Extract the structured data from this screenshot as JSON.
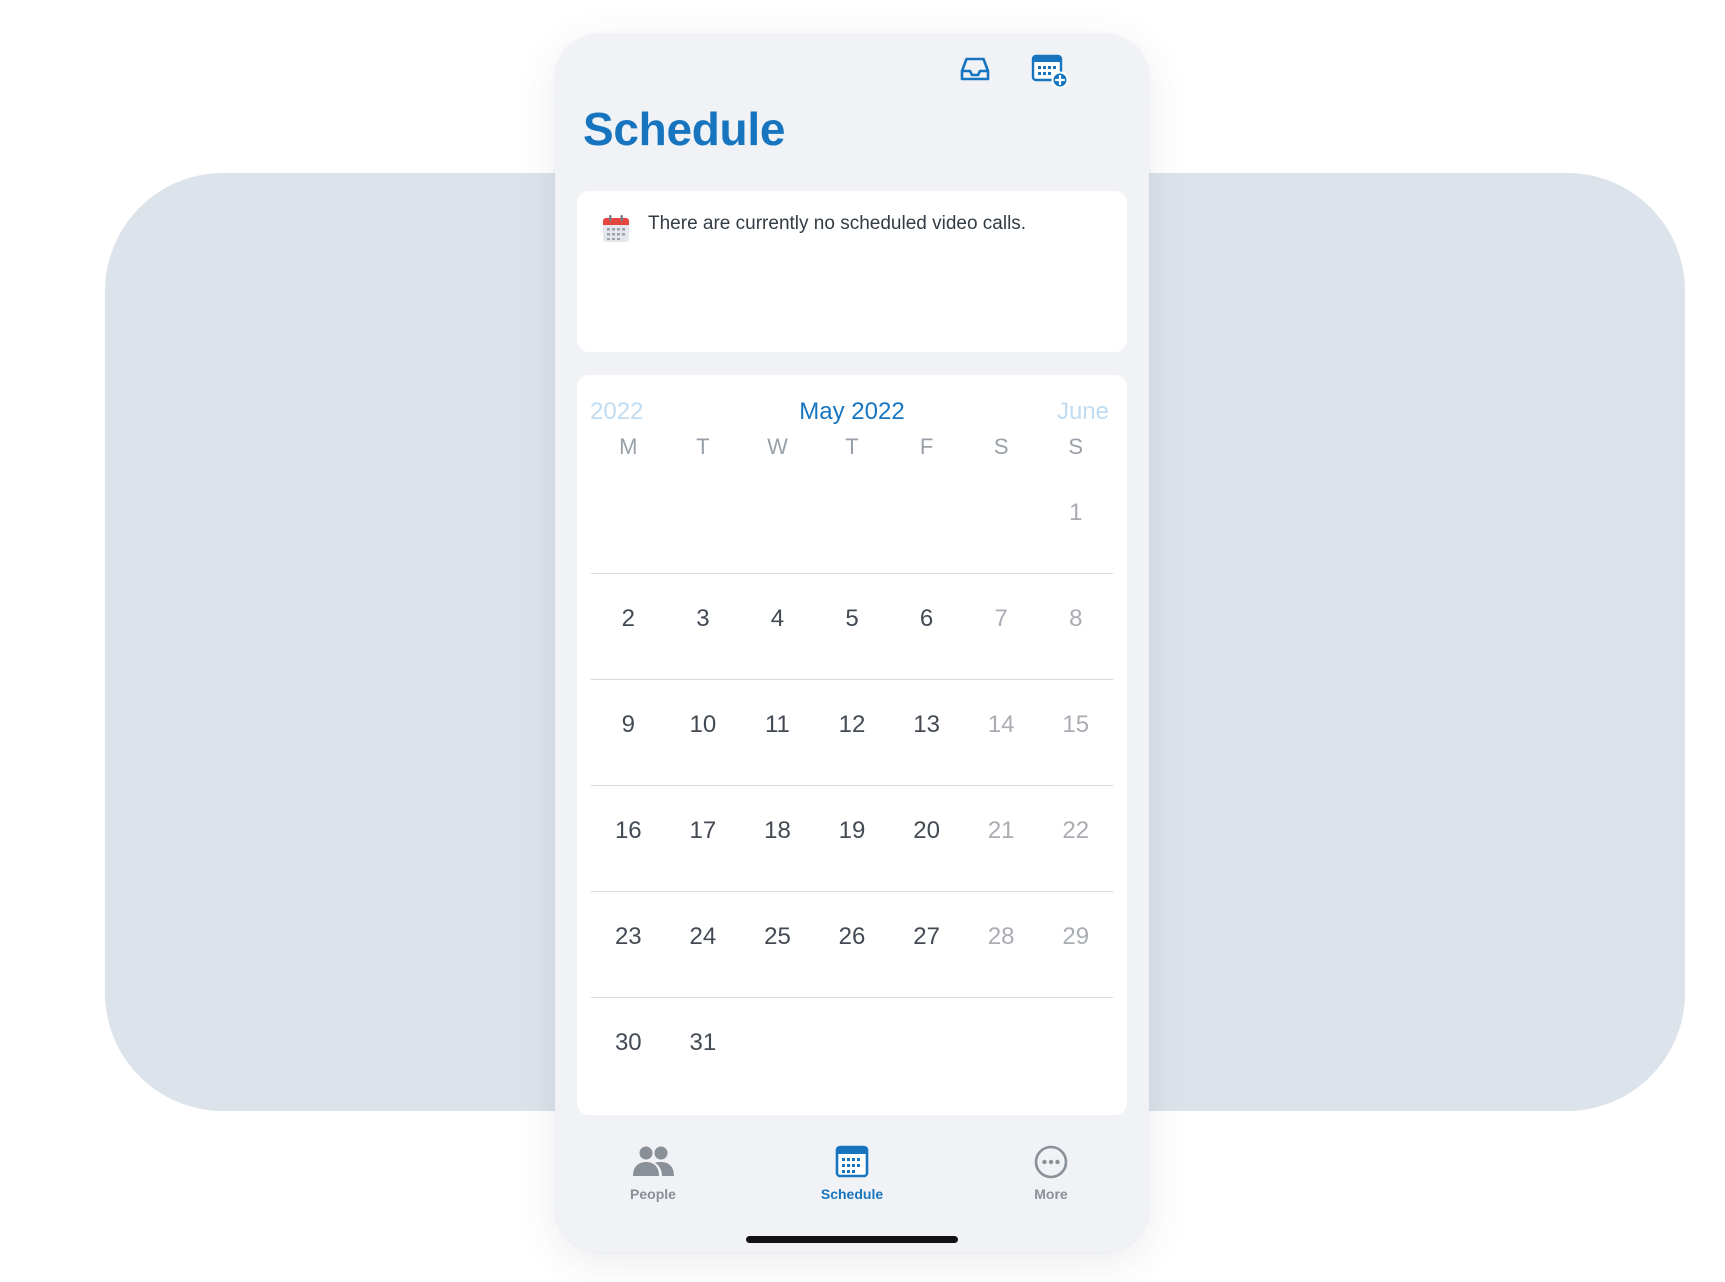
{
  "header": {
    "title": "Schedule",
    "inbox_icon": "inbox-icon",
    "add_event_icon": "calendar-add-icon"
  },
  "notice": {
    "icon": "calendar-icon",
    "text": "There are currently no scheduled video calls."
  },
  "calendar": {
    "prev_label": "2022",
    "month_label": "May 2022",
    "next_label": "June",
    "weekdays": [
      "M",
      "T",
      "W",
      "T",
      "F",
      "S",
      "S"
    ],
    "weeks": [
      [
        "",
        "",
        "",
        "",
        "",
        "",
        "1"
      ],
      [
        "2",
        "3",
        "4",
        "5",
        "6",
        "7",
        "8"
      ],
      [
        "9",
        "10",
        "11",
        "12",
        "13",
        "14",
        "15"
      ],
      [
        "16",
        "17",
        "18",
        "19",
        "20",
        "21",
        "22"
      ],
      [
        "23",
        "24",
        "25",
        "26",
        "27",
        "28",
        "29"
      ],
      [
        "30",
        "31",
        "",
        "",
        "",
        "",
        ""
      ]
    ]
  },
  "tabs": [
    {
      "label": "People",
      "icon": "people-icon",
      "active": false
    },
    {
      "label": "Schedule",
      "icon": "calendar-icon",
      "active": true
    },
    {
      "label": "More",
      "icon": "more-icon",
      "active": false
    }
  ],
  "colors": {
    "accent": "#1775c0",
    "background_shape": "#dce3ea",
    "screen_background": "#f0f2f5",
    "weekend_text": "#a9adb3",
    "muted_nav": "#bfdcf2"
  }
}
